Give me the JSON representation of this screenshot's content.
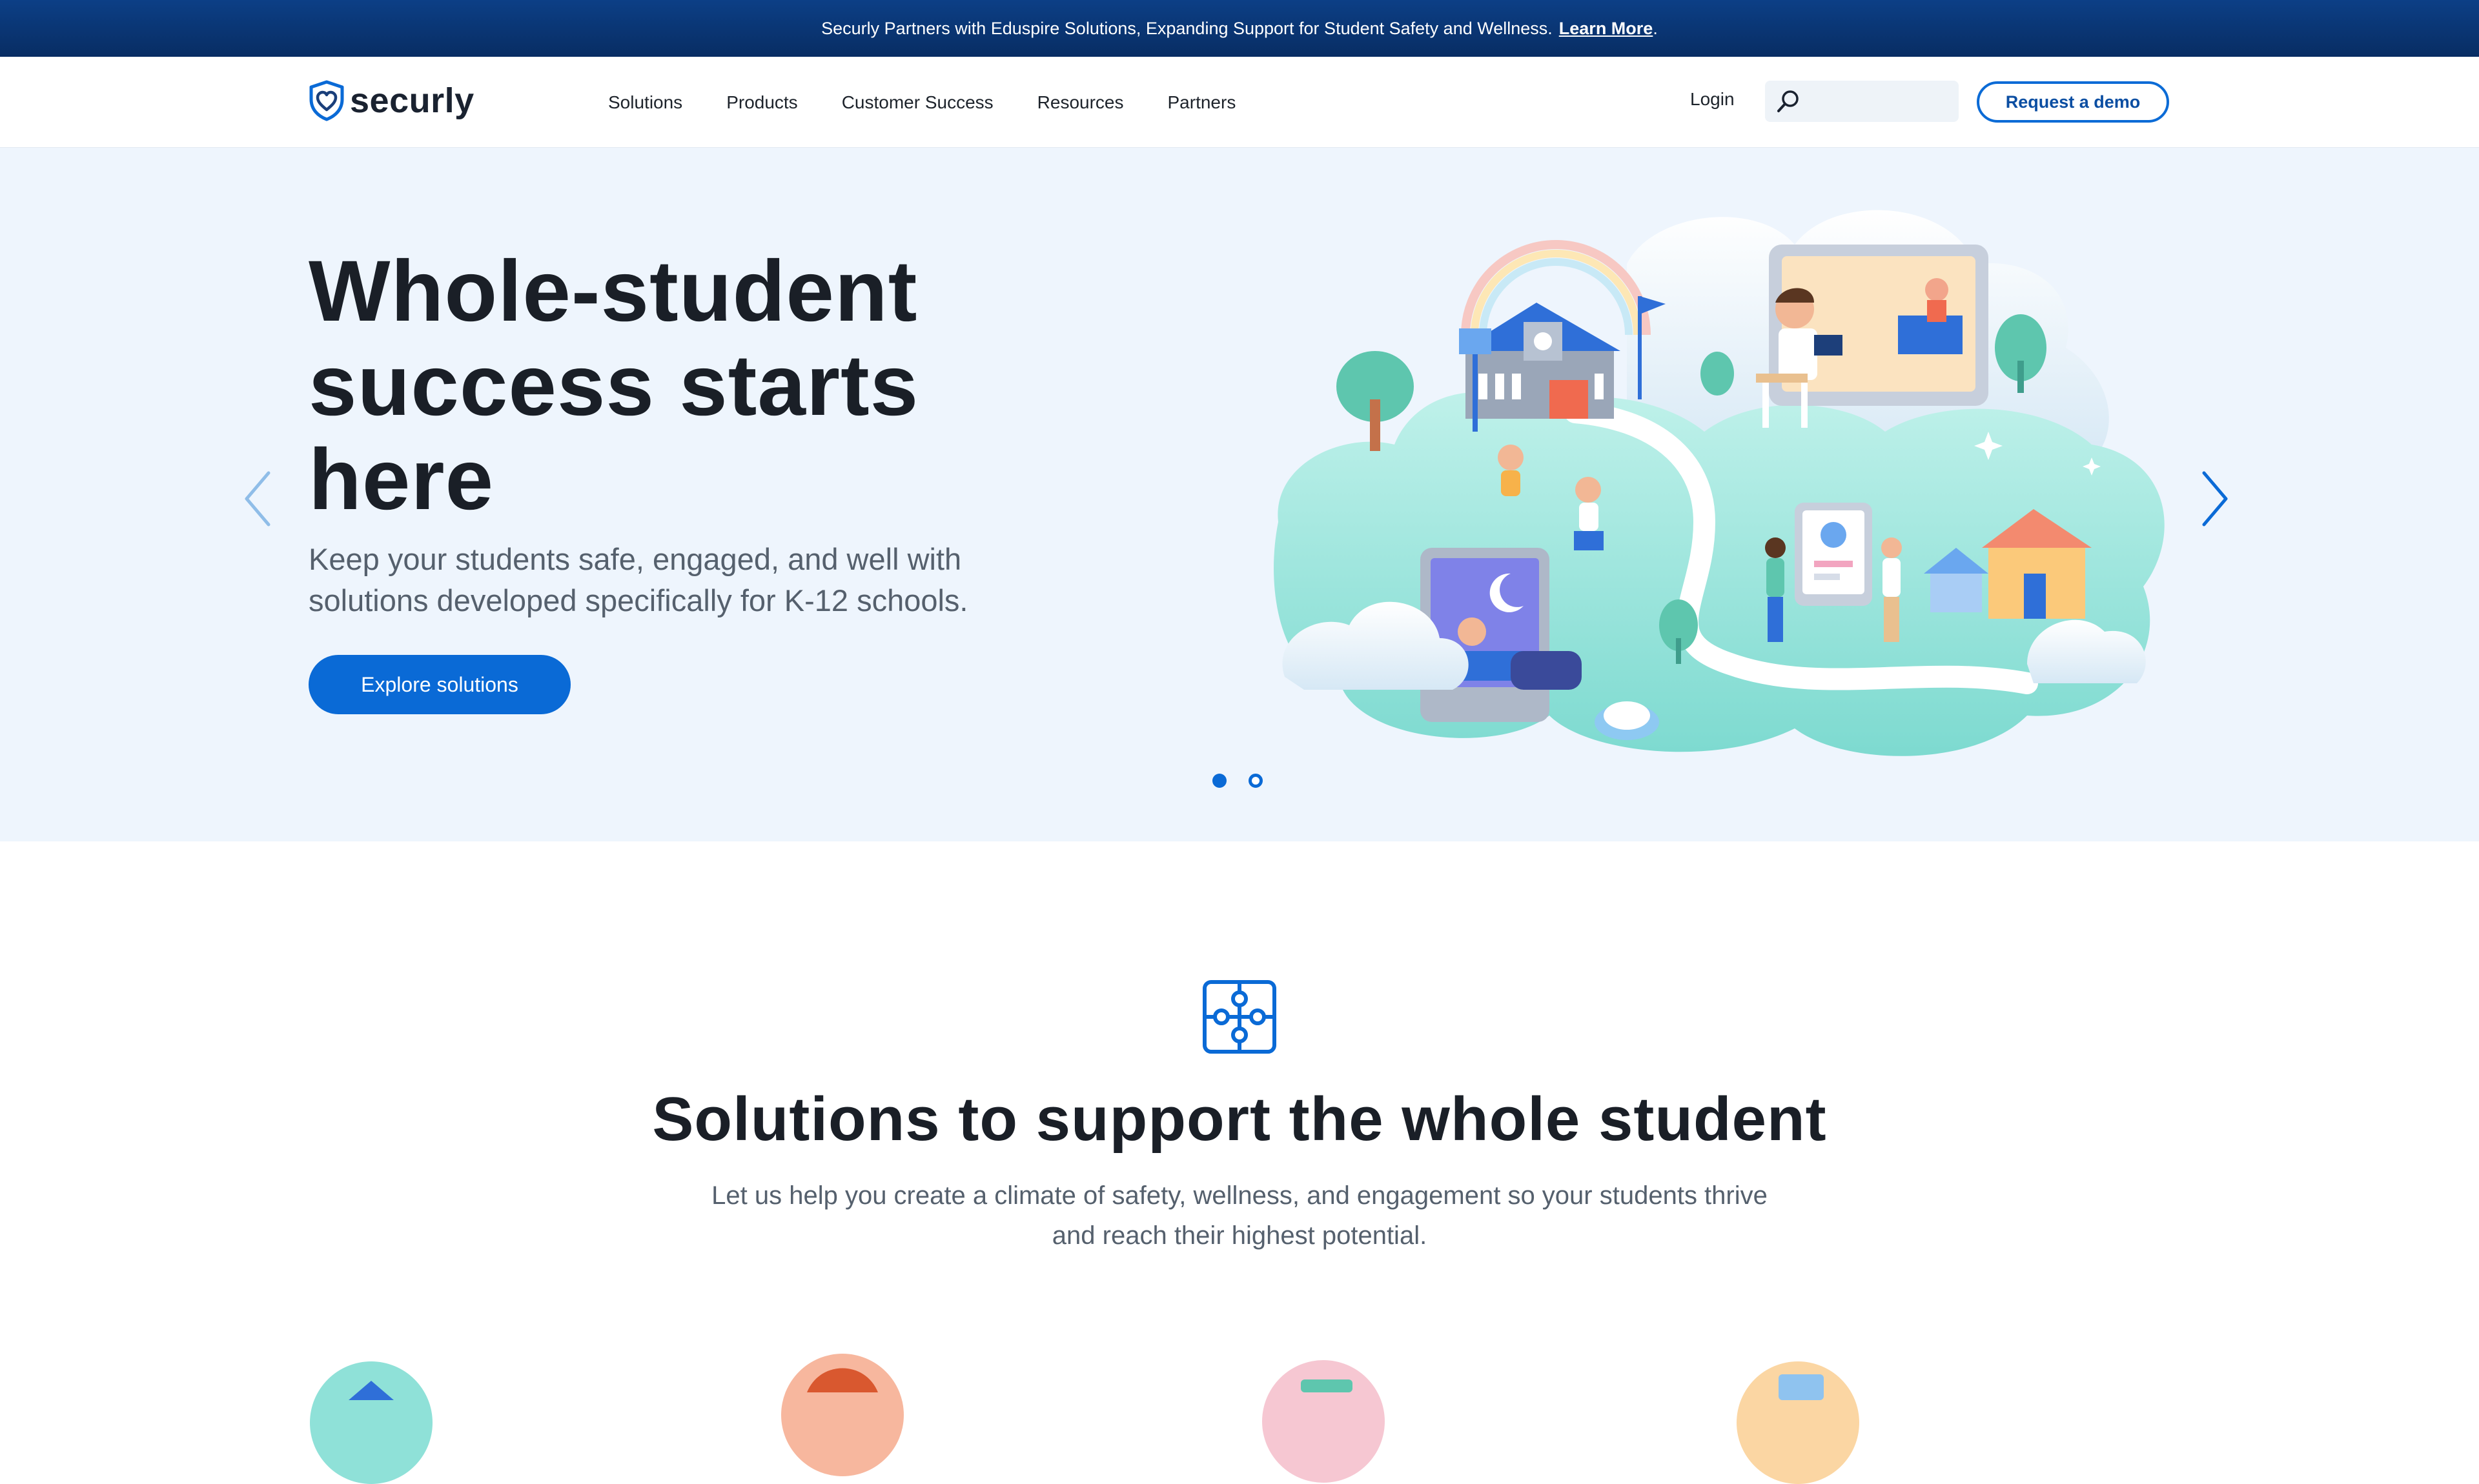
{
  "banner": {
    "text": "Securly Partners with Eduspire Solutions, Expanding Support for Student Safety and Wellness.",
    "link_label": "Learn More",
    "trailing": "."
  },
  "header": {
    "logo_text": "securly",
    "nav": [
      "Solutions",
      "Products",
      "Customer Success",
      "Resources",
      "Partners"
    ],
    "login_label": "Login",
    "search_value": "",
    "search_placeholder": "",
    "demo_label": "Request a demo"
  },
  "hero": {
    "title_line1": "Whole-student",
    "title_line2": "success starts",
    "title_line3": "here",
    "subtitle_line1": "Keep your students safe, engaged, and well with",
    "subtitle_line2": "solutions developed specifically for K-12 schools.",
    "cta_label": "Explore solutions",
    "slides": {
      "current": 1,
      "total": 2
    }
  },
  "solutions": {
    "icon": "puzzle-icon",
    "title": "Solutions to support the whole student",
    "subtitle_line1": "Let us help you create a climate of safety, wellness, and engagement so your students thrive",
    "subtitle_line2": "and reach their highest potential."
  },
  "colors": {
    "brand_blue": "#0a6ad6",
    "banner_navy": "#0b3a7a",
    "hero_bg": "#eef5fd",
    "teal": "#7fdcd0"
  }
}
